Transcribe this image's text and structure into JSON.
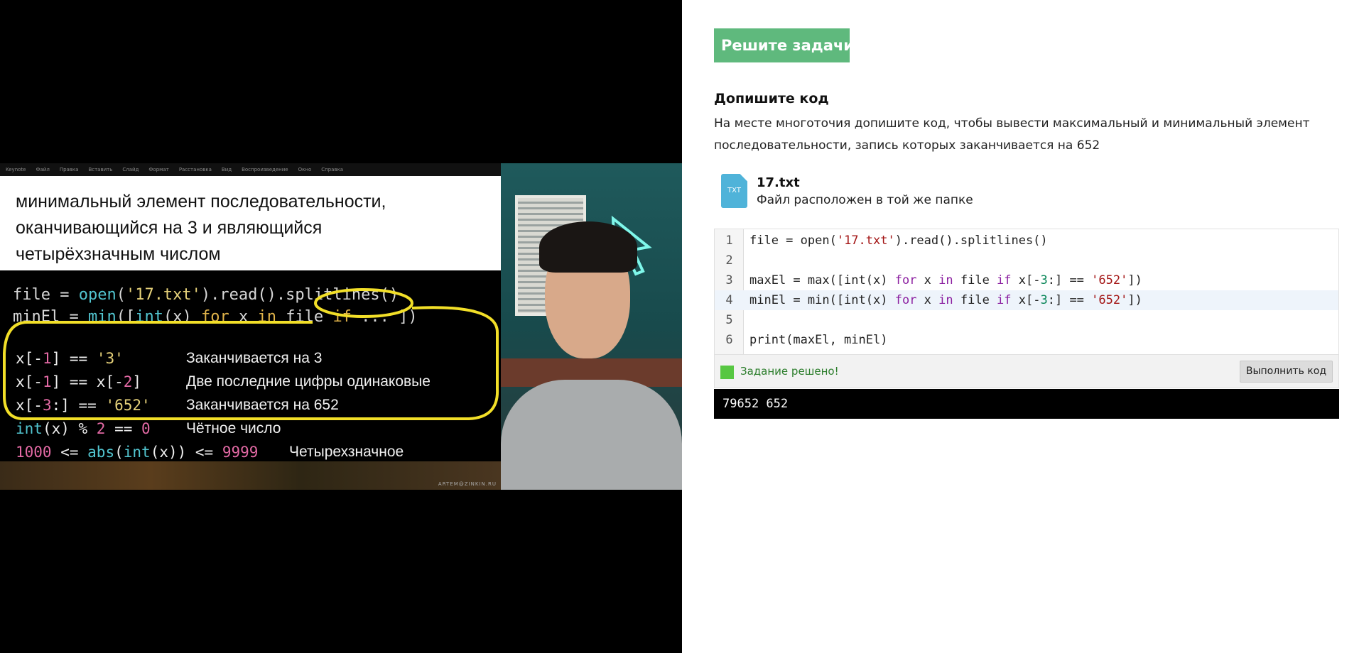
{
  "video": {
    "menubar_items": [
      "Keynote",
      "Файл",
      "Правка",
      "Вставить",
      "Слайд",
      "Формат",
      "Расстановка",
      "Вид",
      "Воспроизведение",
      "Окно",
      "Справка"
    ],
    "slide_title": "минимальный элемент последовательности,\nоканчивающийся на 3 и являющийся\nчетырёхзначным числом",
    "rules": [
      {
        "desc": "Заканчивается на 3"
      },
      {
        "desc": "Две последние цифры одинаковые"
      },
      {
        "desc": "Заканчивается на 652"
      },
      {
        "desc": "Чётное число"
      },
      {
        "desc": "Четырехзначное"
      }
    ],
    "watermark": "ARTEM@ZINKIN.RU"
  },
  "task": {
    "header": "Решите задачи",
    "title": "Допишите код",
    "description": "На месте многоточия допишите код, чтобы вывести максимальный и минимальный элемент последовательности, запись которых заканчивается на 652",
    "file": {
      "icon_label": "TXT",
      "name": "17.txt",
      "note": "Файл расположен в той же папке"
    },
    "editor": {
      "line_numbers": [
        "1",
        "2",
        "3",
        "4",
        "5",
        "6"
      ],
      "active_line": 4
    },
    "status": {
      "text": "Задание решено!",
      "color": "#57c742"
    },
    "run_button": "Выполнить код",
    "output": "79652 652"
  }
}
